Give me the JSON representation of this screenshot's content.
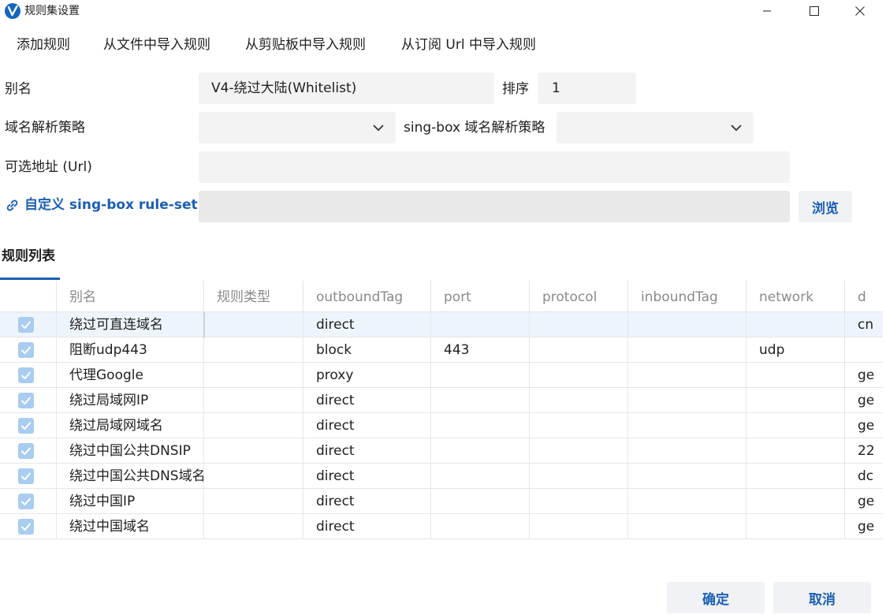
{
  "window": {
    "title": "规则集设置"
  },
  "menu": [
    "添加规则",
    "从文件中导入规则",
    "从剪贴板中导入规则",
    "从订阅 Url 中导入规则"
  ],
  "form": {
    "alias_label": "别名",
    "alias_value": "V4-绕过大陆(Whitelist)",
    "sort_label": "排序",
    "sort_value": "1",
    "domain_strategy_label": "域名解析策略",
    "domain_strategy_value": "",
    "singbox_strategy_label": "sing-box 域名解析策略",
    "singbox_strategy_value": "",
    "url_label": "可选地址 (Url)",
    "url_value": "",
    "ruleset_label": "自定义 sing-box rule-set",
    "ruleset_value": "",
    "browse_label": "浏览"
  },
  "tabs": {
    "active": "规则列表"
  },
  "table": {
    "headers": [
      "",
      "别名",
      "规则类型",
      "outboundTag",
      "port",
      "protocol",
      "inboundTag",
      "network",
      "d"
    ],
    "rows": [
      [
        "",
        "绕过可直连域名",
        "",
        "direct",
        "",
        "",
        "",
        "",
        "cn"
      ],
      [
        "",
        "阻断udp443",
        "",
        "block",
        "443",
        "",
        "",
        "udp",
        ""
      ],
      [
        "",
        "代理Google",
        "",
        "proxy",
        "",
        "",
        "",
        "",
        "ge"
      ],
      [
        "",
        "绕过局域网IP",
        "",
        "direct",
        "",
        "",
        "",
        "",
        "ge"
      ],
      [
        "",
        "绕过局域网域名",
        "",
        "direct",
        "",
        "",
        "",
        "",
        "ge"
      ],
      [
        "",
        "绕过中国公共DNSIP",
        "",
        "direct",
        "",
        "",
        "",
        "",
        "22"
      ],
      [
        "",
        "绕过中国公共DNS域名",
        "",
        "direct",
        "",
        "",
        "",
        "",
        "dc"
      ],
      [
        "",
        "绕过中国IP",
        "",
        "direct",
        "",
        "",
        "",
        "",
        "ge"
      ],
      [
        "",
        "绕过中国域名",
        "",
        "direct",
        "",
        "",
        "",
        "",
        "ge"
      ]
    ]
  },
  "buttons": {
    "ok": "确定",
    "cancel": "取消"
  },
  "colors": {
    "accent": "#1a5fb4",
    "field_bg": "#f3f3f3",
    "checkbox": "#a9cdf0",
    "selected_row": "#eef4fc"
  }
}
